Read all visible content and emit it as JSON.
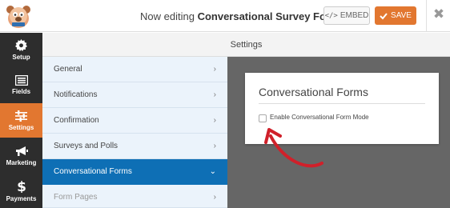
{
  "header": {
    "title_prefix": "Now editing",
    "form_name": "Conversational Survey Form",
    "embed_label": "EMBED",
    "save_label": "SAVE",
    "close_symbol": "✖"
  },
  "sidebar": {
    "items": [
      {
        "label": "Setup",
        "icon": "gear-icon",
        "active": false
      },
      {
        "label": "Fields",
        "icon": "fields-list-icon",
        "active": false
      },
      {
        "label": "Settings",
        "icon": "sliders-icon",
        "active": true
      },
      {
        "label": "Marketing",
        "icon": "megaphone-icon",
        "active": false
      },
      {
        "label": "Payments",
        "icon": "dollar-icon",
        "active": false
      }
    ]
  },
  "settings": {
    "heading": "Settings",
    "items": [
      {
        "label": "General",
        "state": "normal"
      },
      {
        "label": "Notifications",
        "state": "normal"
      },
      {
        "label": "Confirmation",
        "state": "normal"
      },
      {
        "label": "Surveys and Polls",
        "state": "normal"
      },
      {
        "label": "Conversational Forms",
        "state": "active"
      },
      {
        "label": "Form Pages",
        "state": "dim"
      }
    ]
  },
  "panel": {
    "title": "Conversational Forms",
    "checkbox_label": "Enable Conversational Form Mode",
    "checkbox_checked": false
  },
  "colors": {
    "accent": "#e27730",
    "nav_bg": "#2d2d2d",
    "active_item": "#0e6fb5",
    "pane_bg": "#666666",
    "arrow": "#d0202a"
  }
}
